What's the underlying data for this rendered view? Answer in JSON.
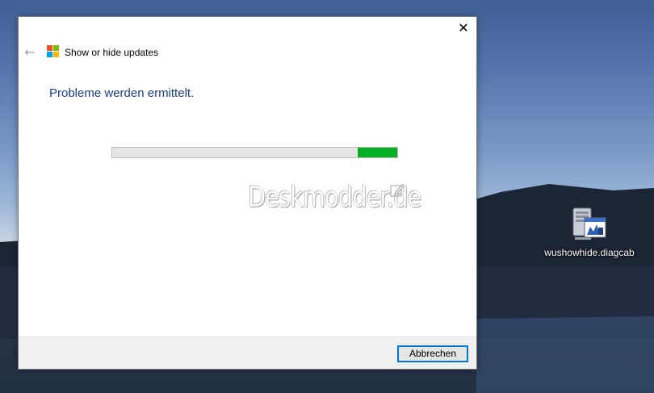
{
  "dialog": {
    "title": "Show or hide updates",
    "heading": "Probleme werden ermittelt.",
    "close_glyph": "✕",
    "back_glyph": "←",
    "progress": {
      "start_fraction": 0.86,
      "end_fraction": 1.0,
      "fill_color": "#06b025",
      "track_color": "#e6e6e6"
    },
    "cancel_label": "Abbrechen"
  },
  "watermark": {
    "text": "Deskmodder.de"
  },
  "desktop": {
    "icon_label": "wushowhide.diagcab",
    "icon": "diagcab-file-icon"
  },
  "colors": {
    "heading": "#1a3d8a",
    "accent": "#0078d7",
    "ms_logo": [
      "#f25022",
      "#7fba00",
      "#00a4ef",
      "#ffb900"
    ]
  }
}
